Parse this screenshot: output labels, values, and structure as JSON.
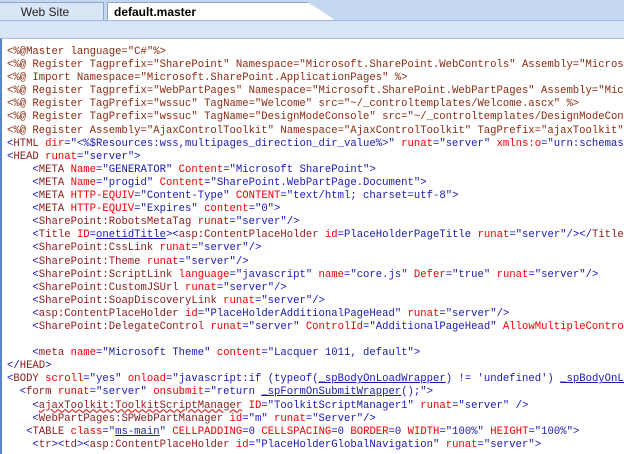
{
  "tabs": [
    {
      "label": "Web Site"
    },
    {
      "label": "default.master"
    }
  ],
  "code": {
    "lines": [
      [
        [
          "d",
          "<%@Master language=\"C#\"%>"
        ]
      ],
      [
        [
          "d",
          "<%@ Register Tagprefix=\"SharePoint\" Namespace=\"Microsoft.SharePoint.WebControls\" Assembly=\"Microsoft.S"
        ]
      ],
      [
        [
          "d",
          "<%@ Import Namespace=\"Microsoft.SharePoint.ApplicationPages\" %>"
        ]
      ],
      [
        [
          "d",
          "<%@ Register Tagprefix=\"WebPartPages\" Namespace=\"Microsoft.SharePoint.WebPartPages\" Assembly=\"Microsof"
        ]
      ],
      [
        [
          "d",
          "<%@ Register TagPrefix=\"wssuc\" TagName=\"Welcome\" src=\"~/_controltemplates/Welcome.ascx\" %>"
        ]
      ],
      [
        [
          "d",
          "<%@ Register TagPrefix=\"wssuc\" TagName=\"DesignModeConsole\" src=\"~/_controltemplates/DesignModeConsole"
        ]
      ],
      [
        [
          "d",
          "<%@ Register Assembly=\"AjaxControlToolkit\" Namespace=\"AjaxControlToolkit\" TagPrefix=\"ajaxToolkit\" %>"
        ]
      ],
      [
        [
          "p",
          "<"
        ],
        [
          "t",
          "HTML"
        ],
        [
          "a",
          " dir"
        ],
        [
          "p",
          "="
        ],
        [
          "v",
          "\"<%$Resources:wss,multipages_direction_dir_value%>\""
        ],
        [
          "a",
          " runat"
        ],
        [
          "p",
          "="
        ],
        [
          "v",
          "\"server\""
        ],
        [
          "a",
          " xmlns:o"
        ],
        [
          "p",
          "="
        ],
        [
          "v",
          "\"urn:schemas-micr"
        ]
      ],
      [
        [
          "p",
          "<"
        ],
        [
          "t",
          "HEAD"
        ],
        [
          "a",
          " runat"
        ],
        [
          "p",
          "="
        ],
        [
          "v",
          "\"server\""
        ],
        [
          "p",
          ">"
        ]
      ],
      [
        [
          "p",
          "    <"
        ],
        [
          "t",
          "META"
        ],
        [
          "a",
          " Name"
        ],
        [
          "p",
          "="
        ],
        [
          "v",
          "\"GENERATOR\""
        ],
        [
          "a",
          " Content"
        ],
        [
          "p",
          "="
        ],
        [
          "v",
          "\"Microsoft SharePoint\""
        ],
        [
          "p",
          ">"
        ]
      ],
      [
        [
          "p",
          "    <"
        ],
        [
          "t",
          "META"
        ],
        [
          "a",
          " Name"
        ],
        [
          "p",
          "="
        ],
        [
          "v",
          "\"progid\""
        ],
        [
          "a",
          " Content"
        ],
        [
          "p",
          "="
        ],
        [
          "v",
          "\"SharePoint.WebPartPage.Document\""
        ],
        [
          "p",
          ">"
        ]
      ],
      [
        [
          "p",
          "    <"
        ],
        [
          "t",
          "META"
        ],
        [
          "a",
          " HTTP-EQUIV"
        ],
        [
          "p",
          "="
        ],
        [
          "v",
          "\"Content-Type\""
        ],
        [
          "a",
          " CONTENT"
        ],
        [
          "p",
          "="
        ],
        [
          "v",
          "\"text/html; charset=utf-8\""
        ],
        [
          "p",
          ">"
        ]
      ],
      [
        [
          "p",
          "    <"
        ],
        [
          "t",
          "META"
        ],
        [
          "a",
          " HTTP-EQUIV"
        ],
        [
          "p",
          "="
        ],
        [
          "v",
          "\"Expires\""
        ],
        [
          "a",
          " content"
        ],
        [
          "p",
          "="
        ],
        [
          "v",
          "\"0\""
        ],
        [
          "p",
          ">"
        ]
      ],
      [
        [
          "p",
          "    <"
        ],
        [
          "t",
          "SharePoint:RobotsMetaTag"
        ],
        [
          "a",
          " runat"
        ],
        [
          "p",
          "="
        ],
        [
          "v",
          "\"server\""
        ],
        [
          "p",
          "/>"
        ]
      ],
      [
        [
          "p",
          "    <"
        ],
        [
          "t",
          "Title"
        ],
        [
          "a",
          " ID"
        ],
        [
          "p",
          "="
        ],
        [
          "vu",
          "onetidTitle"
        ],
        [
          "p",
          "><"
        ],
        [
          "t",
          "asp:ContentPlaceHolder"
        ],
        [
          "a",
          " id"
        ],
        [
          "p",
          "="
        ],
        [
          "v",
          "PlaceHolderPageTitle"
        ],
        [
          "a",
          " runat"
        ],
        [
          "p",
          "="
        ],
        [
          "v",
          "\"server\""
        ],
        [
          "p",
          "/></"
        ],
        [
          "t",
          "Title"
        ],
        [
          "p",
          ">"
        ]
      ],
      [
        [
          "p",
          "    <"
        ],
        [
          "t",
          "SharePoint:CssLink"
        ],
        [
          "a",
          " runat"
        ],
        [
          "p",
          "="
        ],
        [
          "v",
          "\"server\""
        ],
        [
          "p",
          "/>"
        ]
      ],
      [
        [
          "p",
          "    <"
        ],
        [
          "t",
          "SharePoint:Theme"
        ],
        [
          "a",
          " runat"
        ],
        [
          "p",
          "="
        ],
        [
          "v",
          "\"server\""
        ],
        [
          "p",
          "/>"
        ]
      ],
      [
        [
          "p",
          "    <"
        ],
        [
          "t",
          "SharePoint:ScriptLink"
        ],
        [
          "a",
          " language"
        ],
        [
          "p",
          "="
        ],
        [
          "v",
          "\"javascript\""
        ],
        [
          "a",
          " name"
        ],
        [
          "p",
          "="
        ],
        [
          "v",
          "\"core.js\""
        ],
        [
          "a",
          " Defer"
        ],
        [
          "p",
          "="
        ],
        [
          "v",
          "\"true\""
        ],
        [
          "a",
          " runat"
        ],
        [
          "p",
          "="
        ],
        [
          "v",
          "\"server\""
        ],
        [
          "p",
          "/>"
        ]
      ],
      [
        [
          "p",
          "    <"
        ],
        [
          "t",
          "SharePoint:CustomJSUrl"
        ],
        [
          "a",
          " runat"
        ],
        [
          "p",
          "="
        ],
        [
          "v",
          "\"server\""
        ],
        [
          "p",
          "/>"
        ]
      ],
      [
        [
          "p",
          "    <"
        ],
        [
          "t",
          "SharePoint:SoapDiscoveryLink"
        ],
        [
          "a",
          " runat"
        ],
        [
          "p",
          "="
        ],
        [
          "v",
          "\"server\""
        ],
        [
          "p",
          "/>"
        ]
      ],
      [
        [
          "p",
          "    <"
        ],
        [
          "t",
          "asp:ContentPlaceHolder"
        ],
        [
          "a",
          " id"
        ],
        [
          "p",
          "="
        ],
        [
          "v",
          "\"PlaceHolderAdditionalPageHead\""
        ],
        [
          "a",
          " runat"
        ],
        [
          "p",
          "="
        ],
        [
          "v",
          "\"server\""
        ],
        [
          "p",
          "/>"
        ]
      ],
      [
        [
          "p",
          "    <"
        ],
        [
          "t",
          "SharePoint:DelegateControl"
        ],
        [
          "a",
          " runat"
        ],
        [
          "p",
          "="
        ],
        [
          "v",
          "\"server\""
        ],
        [
          "a",
          " ControlId"
        ],
        [
          "p",
          "="
        ],
        [
          "v",
          "\"AdditionalPageHead\""
        ],
        [
          "a",
          " AllowMultipleControls"
        ],
        [
          "p",
          "=\""
        ]
      ],
      [],
      [
        [
          "p",
          "    <"
        ],
        [
          "t",
          "meta"
        ],
        [
          "a",
          " name"
        ],
        [
          "p",
          "="
        ],
        [
          "v",
          "\"Microsoft Theme\""
        ],
        [
          "a",
          " content"
        ],
        [
          "p",
          "="
        ],
        [
          "v",
          "\"Lacquer 1011, default\""
        ],
        [
          "p",
          ">"
        ]
      ],
      [
        [
          "p",
          "</"
        ],
        [
          "t",
          "HEAD"
        ],
        [
          "p",
          ">"
        ]
      ],
      [
        [
          "p",
          "<"
        ],
        [
          "t",
          "BODY"
        ],
        [
          "a",
          " scroll"
        ],
        [
          "p",
          "="
        ],
        [
          "v",
          "\"yes\""
        ],
        [
          "a",
          " onload"
        ],
        [
          "p",
          "="
        ],
        [
          "v",
          "\"javascript:if (typeof("
        ],
        [
          "vu",
          "_spBodyOnLoadWrapper"
        ],
        [
          "v",
          ") != 'undefined') "
        ],
        [
          "vu",
          "_spBodyOnLoadW"
        ]
      ],
      [
        [
          "p",
          "  <"
        ],
        [
          "t",
          "form"
        ],
        [
          "a",
          " runat"
        ],
        [
          "p",
          "="
        ],
        [
          "v",
          "\"server\""
        ],
        [
          "a",
          " onsubmit"
        ],
        [
          "p",
          "="
        ],
        [
          "v",
          "\"return "
        ],
        [
          "vu",
          "_spFormOnSubmitWrapper"
        ],
        [
          "v",
          "();\""
        ],
        [
          "p",
          ">"
        ]
      ],
      [
        [
          "p",
          "    <"
        ],
        [
          "tw",
          "ajaxToolkit:ToolkitScriptManager"
        ],
        [
          "a",
          " ID"
        ],
        [
          "p",
          "="
        ],
        [
          "v",
          "\"ToolkitScriptManager1\""
        ],
        [
          "a",
          " runat"
        ],
        [
          "p",
          "="
        ],
        [
          "v",
          "\"server\""
        ],
        [
          "p",
          " />"
        ]
      ],
      [
        [
          "p",
          "    <"
        ],
        [
          "t",
          "WebPartPages:SPWebPartManager"
        ],
        [
          "a",
          " id"
        ],
        [
          "p",
          "="
        ],
        [
          "v",
          "\"m\""
        ],
        [
          "a",
          " runat"
        ],
        [
          "p",
          "="
        ],
        [
          "v",
          "\"Server\""
        ],
        [
          "p",
          "/>"
        ]
      ],
      [
        [
          "p",
          "   <"
        ],
        [
          "t",
          "TABLE"
        ],
        [
          "a",
          " class"
        ],
        [
          "p",
          "="
        ],
        [
          "v",
          "\""
        ],
        [
          "vu",
          "ms-main"
        ],
        [
          "v",
          "\""
        ],
        [
          "a",
          " CELLPADDING"
        ],
        [
          "p",
          "="
        ],
        [
          "v",
          "0"
        ],
        [
          "a",
          " CELLSPACING"
        ],
        [
          "p",
          "="
        ],
        [
          "v",
          "0"
        ],
        [
          "a",
          " BORDER"
        ],
        [
          "p",
          "="
        ],
        [
          "v",
          "0"
        ],
        [
          "a",
          " WIDTH"
        ],
        [
          "p",
          "="
        ],
        [
          "v",
          "\"100%\""
        ],
        [
          "a",
          " HEIGHT"
        ],
        [
          "p",
          "="
        ],
        [
          "v",
          "\"100%\""
        ],
        [
          "p",
          ">"
        ]
      ],
      [
        [
          "p",
          "    <"
        ],
        [
          "t",
          "tr"
        ],
        [
          "p",
          "><"
        ],
        [
          "t",
          "td"
        ],
        [
          "p",
          "><"
        ],
        [
          "t",
          "asp:ContentPlaceHolder"
        ],
        [
          "a",
          " id"
        ],
        [
          "p",
          "="
        ],
        [
          "v",
          "\"PlaceHolderGlobalNavigation\""
        ],
        [
          "a",
          " runat"
        ],
        [
          "p",
          "="
        ],
        [
          "v",
          "\"server\""
        ],
        [
          "p",
          ">"
        ]
      ]
    ]
  }
}
